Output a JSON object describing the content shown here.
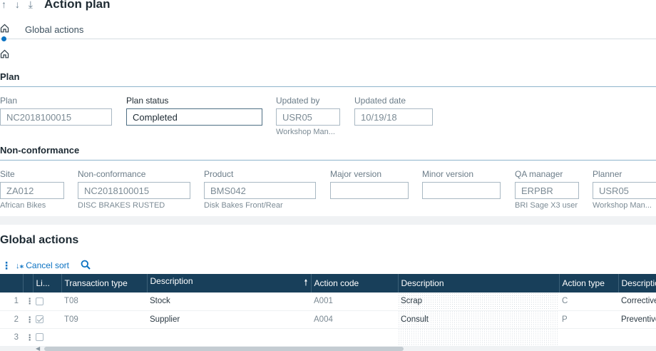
{
  "header": {
    "nav_arrows": "↑ ↓ ⤓",
    "title": "Action plan"
  },
  "breadcrumb": {
    "label": "Global actions"
  },
  "plan_section": {
    "title": "Plan",
    "fields": {
      "plan": {
        "label": "Plan",
        "value": "NC2018100015"
      },
      "plan_status": {
        "label": "Plan status",
        "value": "Completed"
      },
      "updated_by": {
        "label": "Updated by",
        "value": "USR05",
        "sub": "Workshop Man..."
      },
      "updated_date": {
        "label": "Updated date",
        "value": "10/19/18"
      }
    }
  },
  "nc_section": {
    "title": "Non-conformance",
    "fields": {
      "site": {
        "label": "Site",
        "value": "ZA012",
        "sub": "African Bikes"
      },
      "non_conformance": {
        "label": "Non-conformance",
        "value": "NC2018100015",
        "sub": "DISC BRAKES RUSTED"
      },
      "product": {
        "label": "Product",
        "value": "BMS042",
        "sub": "Disk Bakes Front/Rear"
      },
      "major_version": {
        "label": "Major version",
        "value": ""
      },
      "minor_version": {
        "label": "Minor version",
        "value": ""
      },
      "qa_manager": {
        "label": "QA manager",
        "value": "ERPBR",
        "sub": "BRI Sage X3 user"
      },
      "planner": {
        "label": "Planner",
        "value": "USR05",
        "sub": "Workshop Man..."
      }
    }
  },
  "global_actions": {
    "title": "Global actions",
    "toolbar": {
      "cancel_sort": "Cancel sort"
    },
    "columns": [
      "Li...",
      "Transaction type",
      "Description",
      "Action code",
      "Description",
      "Action type",
      "Description"
    ],
    "rows": [
      {
        "num": "1",
        "checked": false,
        "transaction_type": "T08",
        "description": "Stock",
        "action_code": "A001",
        "action_description": "Scrap",
        "action_type": "C",
        "type_description": "Corrective"
      },
      {
        "num": "2",
        "checked": true,
        "transaction_type": "T09",
        "description": "Supplier",
        "action_code": "A004",
        "action_description": "Consult",
        "action_type": "P",
        "type_description": "Preventive"
      },
      {
        "num": "3",
        "checked": false,
        "transaction_type": "",
        "description": "",
        "action_code": "",
        "action_description": "",
        "action_type": "",
        "type_description": ""
      }
    ]
  },
  "colors": {
    "accent": "#0b72c2",
    "grid_header": "#183f5a",
    "section_line": "#8fb5cc"
  },
  "icons": [
    "home-icon",
    "kebab-menu-icon",
    "cancel-sort-icon",
    "search-icon"
  ]
}
